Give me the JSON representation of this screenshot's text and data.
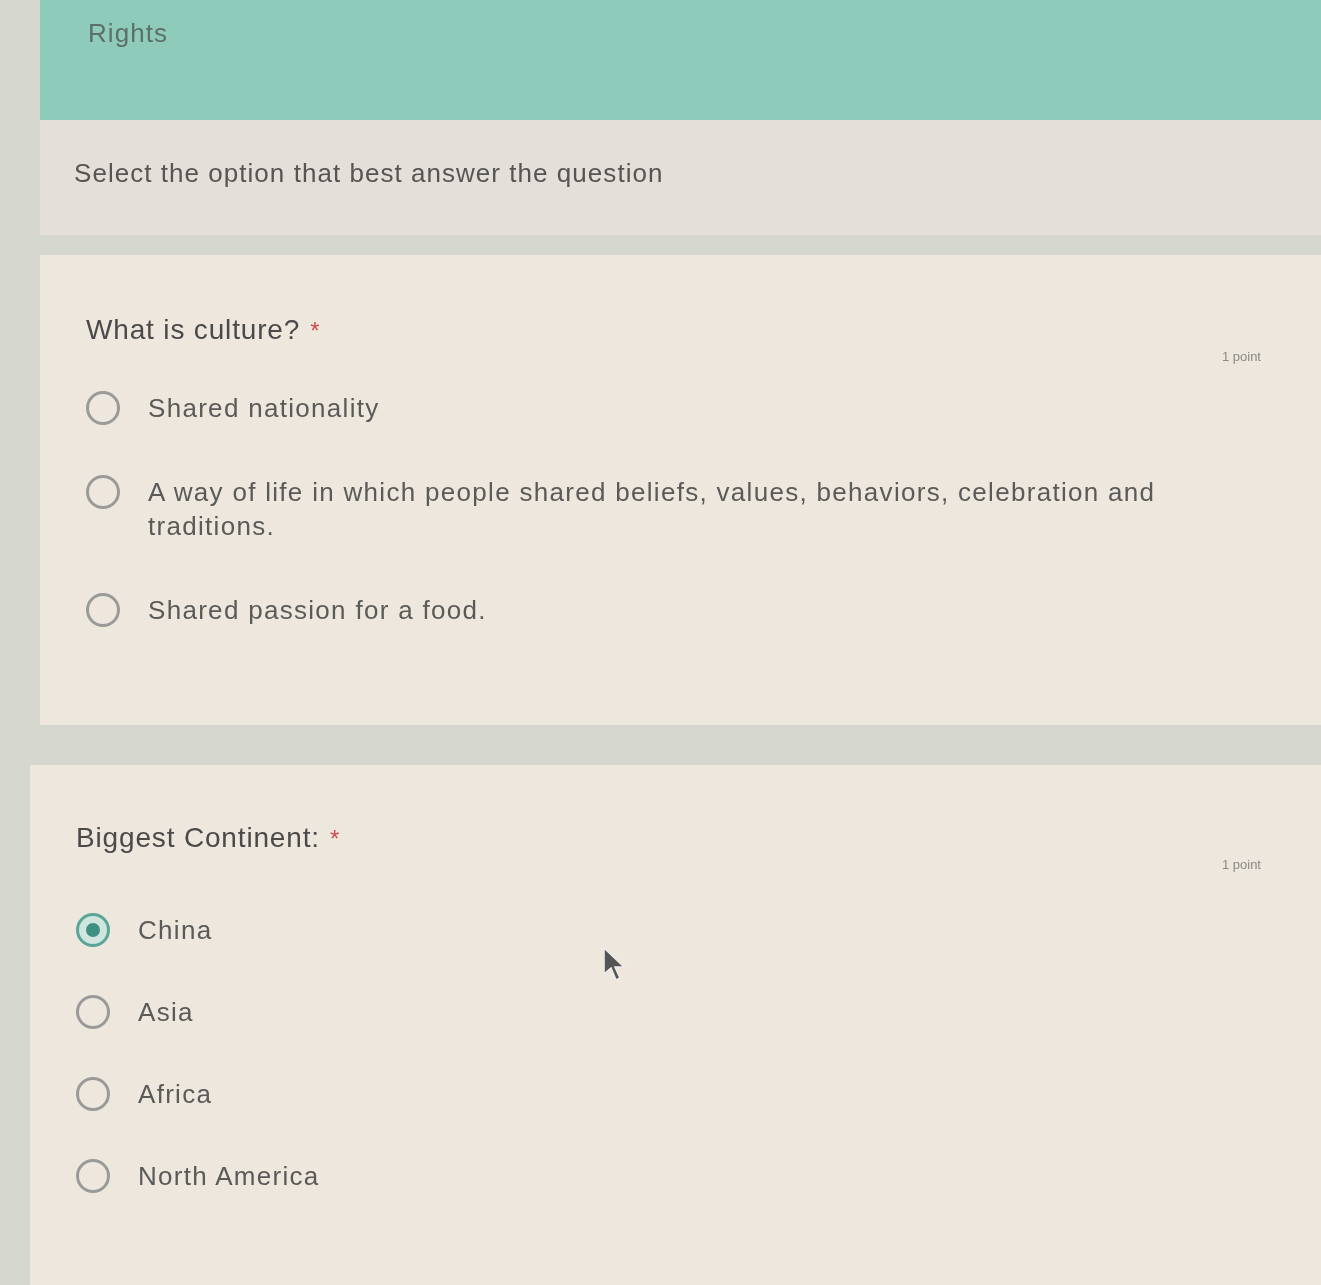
{
  "form": {
    "title": "Rights",
    "description": "Select the option that best answer the question"
  },
  "questions": [
    {
      "title": "What is culture?",
      "required_mark": "*",
      "points": "1 point",
      "options": [
        {
          "label": "Shared nationality",
          "selected": false
        },
        {
          "label": "A way of life in which people shared beliefs, values, behaviors, celebration and traditions.",
          "selected": false
        },
        {
          "label": "Shared passion for a food.",
          "selected": false
        }
      ]
    },
    {
      "title": "Biggest Continent:",
      "required_mark": "*",
      "points": "1 point",
      "options": [
        {
          "label": "China",
          "selected": true
        },
        {
          "label": "Asia",
          "selected": false
        },
        {
          "label": "Africa",
          "selected": false
        },
        {
          "label": "North America",
          "selected": false
        }
      ]
    }
  ]
}
